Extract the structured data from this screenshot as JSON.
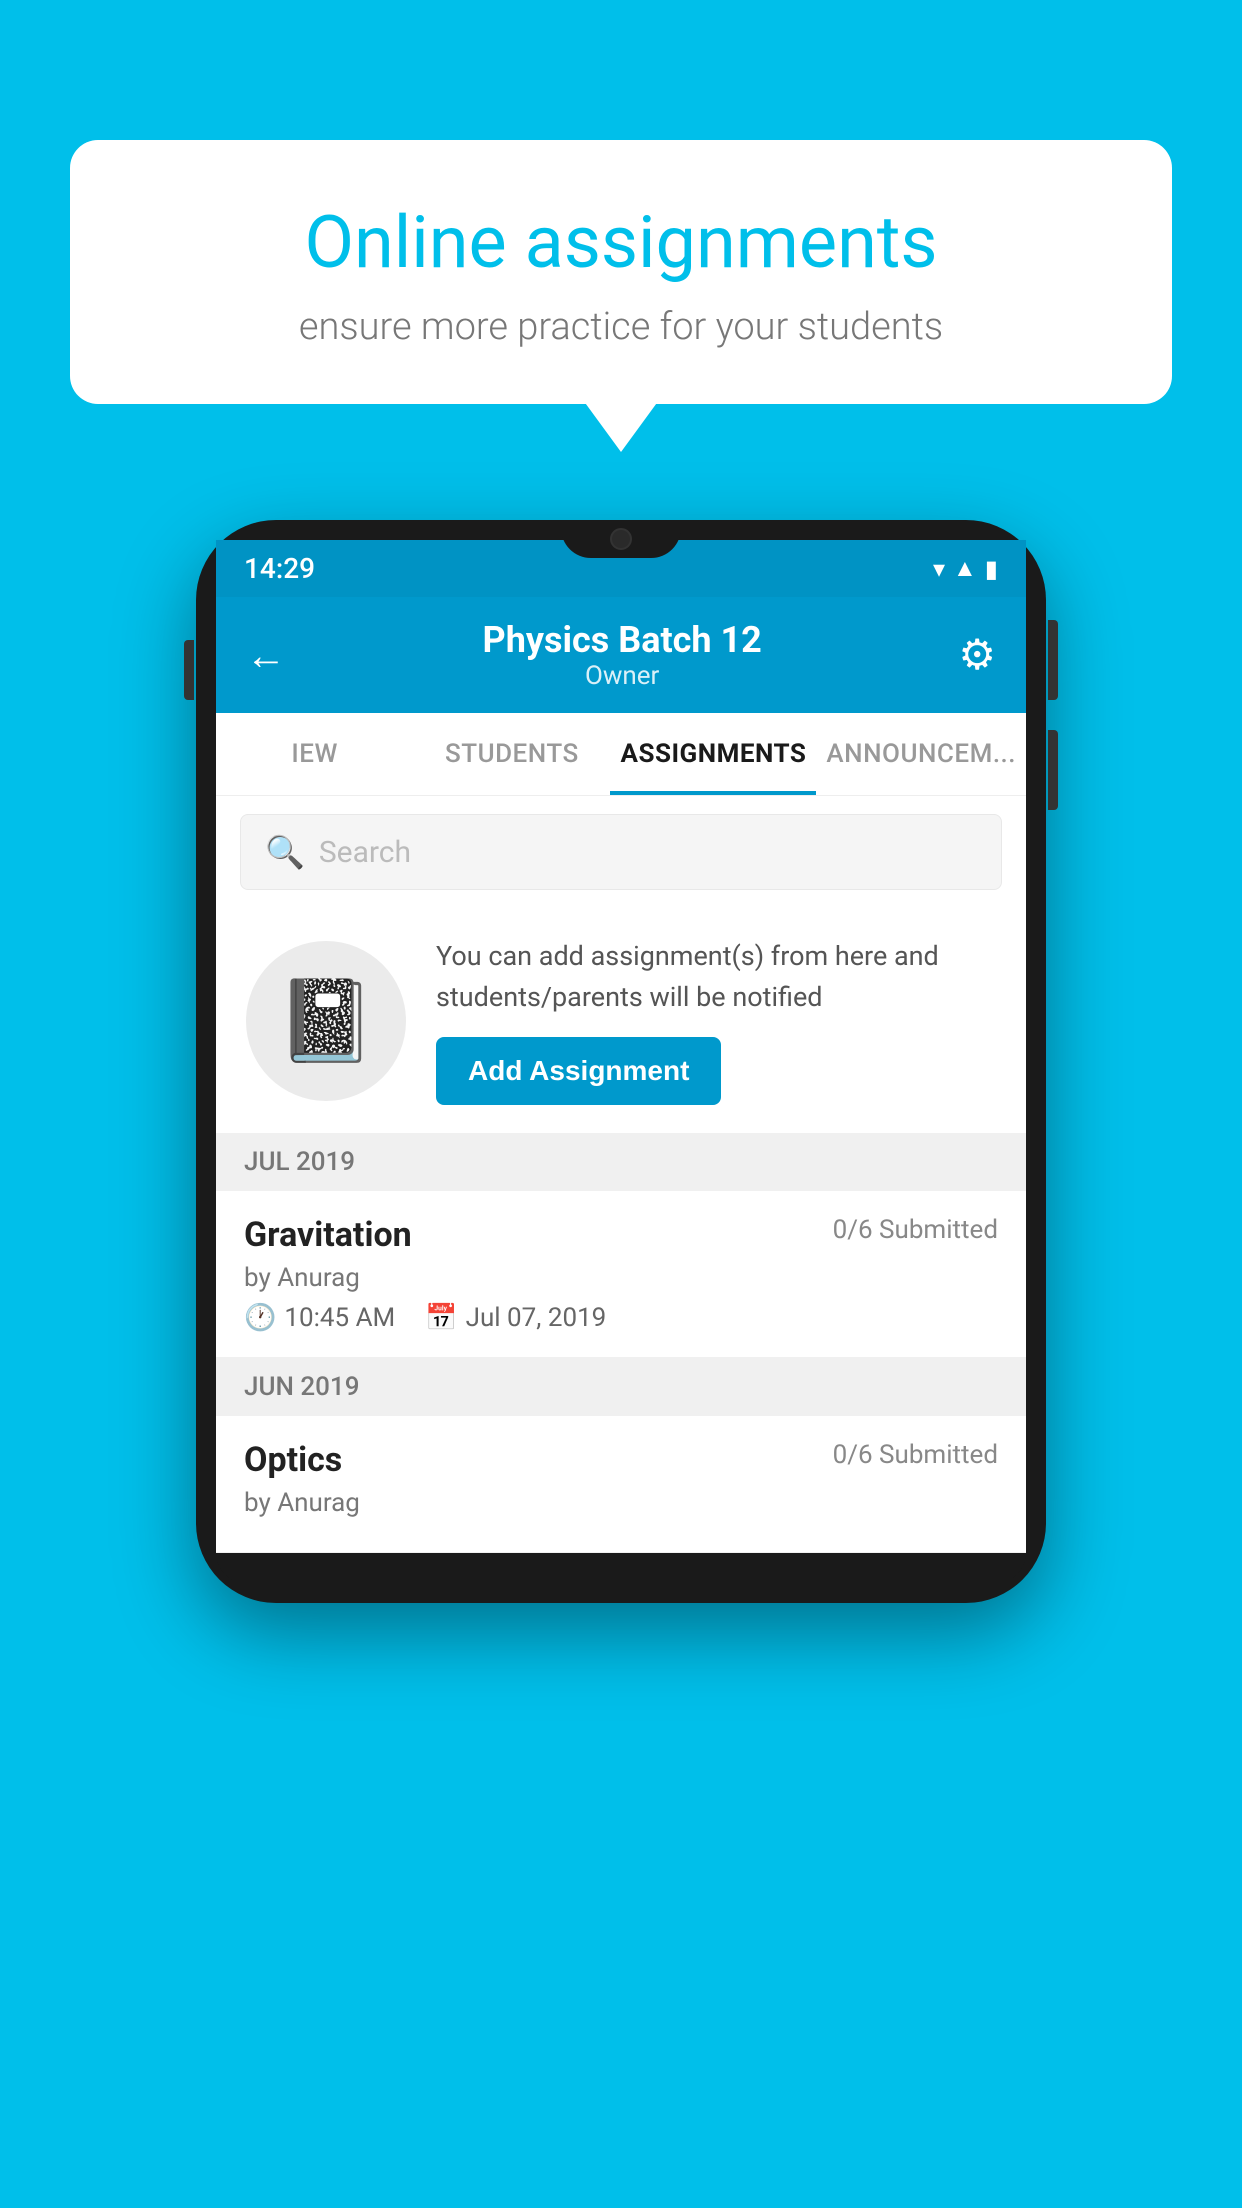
{
  "background": {
    "color": "#00BFEA"
  },
  "speech_bubble": {
    "title": "Online assignments",
    "subtitle": "ensure more practice for your students"
  },
  "phone": {
    "status_bar": {
      "time": "14:29",
      "wifi": "▾",
      "signal": "▾",
      "battery": "▮"
    },
    "header": {
      "title": "Physics Batch 12",
      "subtitle": "Owner",
      "back_label": "←",
      "settings_label": "⚙"
    },
    "tabs": [
      {
        "label": "IEW",
        "active": false
      },
      {
        "label": "STUDENTS",
        "active": false
      },
      {
        "label": "ASSIGNMENTS",
        "active": true
      },
      {
        "label": "ANNOUNCEM...",
        "active": false
      }
    ],
    "search": {
      "placeholder": "Search"
    },
    "promo": {
      "text": "You can add assignment(s) from here and students/parents will be notified",
      "button_label": "Add Assignment"
    },
    "month_groups": [
      {
        "label": "JUL 2019",
        "assignments": [
          {
            "title": "Gravitation",
            "submitted": "0/6 Submitted",
            "author": "by Anurag",
            "time": "10:45 AM",
            "date": "Jul 07, 2019"
          }
        ]
      },
      {
        "label": "JUN 2019",
        "assignments": [
          {
            "title": "Optics",
            "submitted": "0/6 Submitted",
            "author": "by Anurag",
            "time": "",
            "date": ""
          }
        ]
      }
    ]
  }
}
